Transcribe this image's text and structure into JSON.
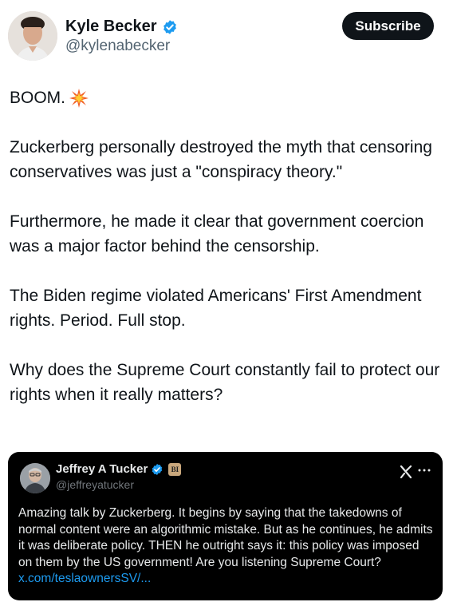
{
  "post": {
    "author_name": "Kyle Becker",
    "author_handle": "@kylenabecker",
    "subscribe_label": "Subscribe",
    "boom": "BOOM.",
    "paragraphs": [
      "Zuckerberg personally destroyed the myth that censoring conservatives was just a \"conspiracy theory.\"",
      "Furthermore, he made it clear that government coercion was a major factor behind the censorship.",
      "The Biden regime violated Americans' First Amendment rights. Period. Full stop.",
      "Why does the Supreme Court constantly fail to protect our rights when it really matters?"
    ]
  },
  "quoted": {
    "author_name": "Jeffrey A Tucker",
    "author_handle": "@jeffreyatucker",
    "badge_text": "BI",
    "text": "Amazing talk by Zuckerberg. It begins by saying that the takedowns of normal content were an algorithmic mistake. But as he continues, he admits it was deliberate policy. THEN he outright says it: this policy was imposed on them by the US government! Are you listening Supreme Court?",
    "link": "x.com/teslaownersSV/..."
  },
  "icons": {
    "verified": "verified-badge-icon",
    "boom_emoji": "collision-icon",
    "grok": "grok-icon",
    "more": "more-icon"
  },
  "colors": {
    "verified_blue": "#1d9bf0",
    "subscribe_bg": "#0f1419",
    "quote_bg": "#000000",
    "link": "#1d9bf0"
  }
}
